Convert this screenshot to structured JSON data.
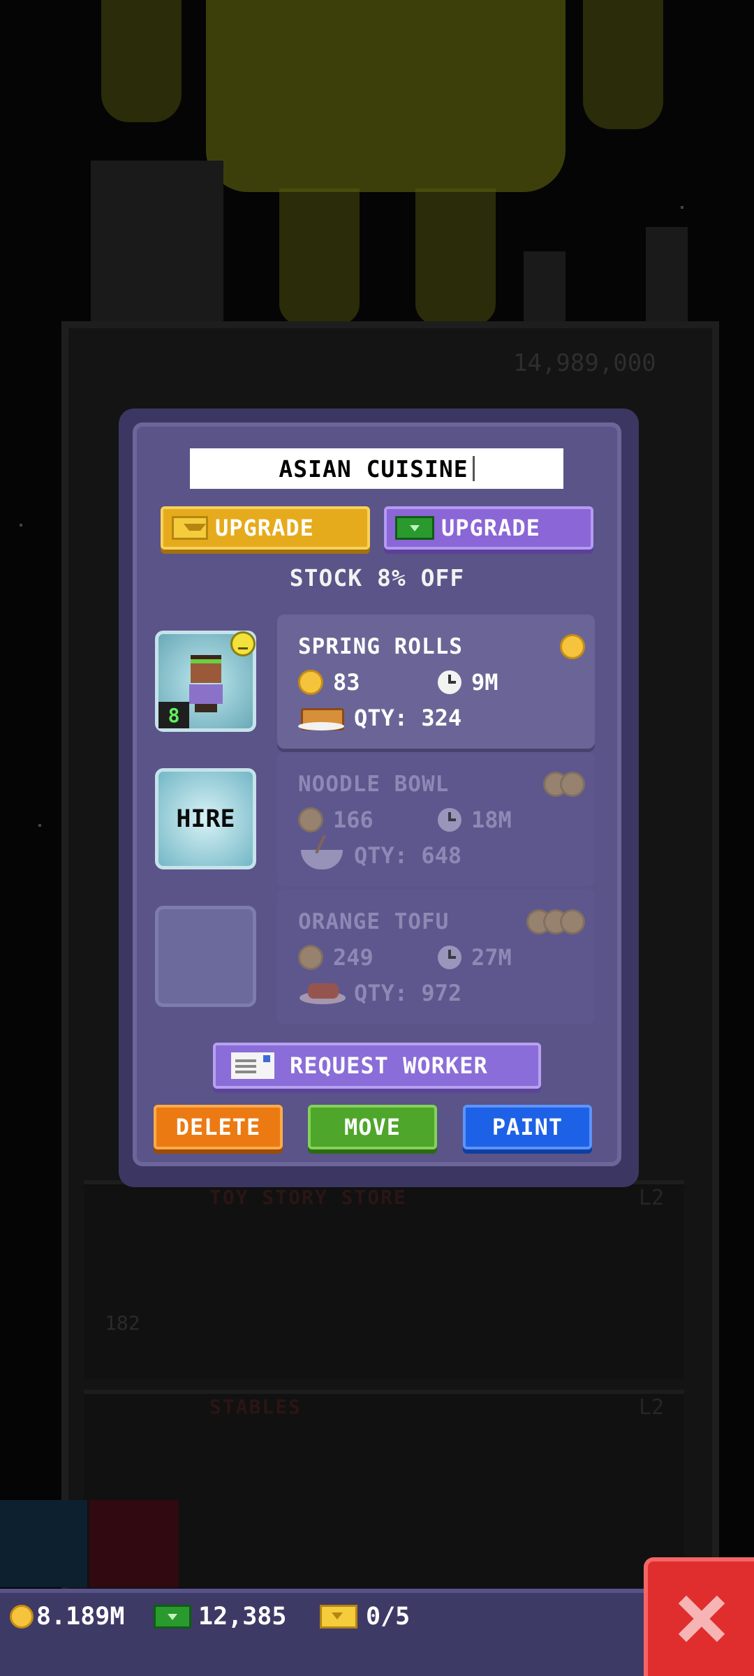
{
  "background": {
    "tower_price": "14,989,000",
    "floor_a": {
      "name": "TOY STORY STORE",
      "level": "L2"
    },
    "floor_b": {
      "name": "STABLES",
      "level": "L2"
    },
    "floor_number": "182"
  },
  "modal": {
    "floor_name": "ASIAN CUISINE",
    "upgrade_coins_label": "UPGRADE",
    "upgrade_bux_label": "UPGRADE",
    "stock_discount": "STOCK 8% OFF",
    "workers": [
      {
        "state": "hired",
        "level": "8"
      },
      {
        "state": "hire",
        "label": "HIRE"
      },
      {
        "state": "locked"
      }
    ],
    "stocks": [
      {
        "name": "SPRING ROLLS",
        "price": "83",
        "time": "9M",
        "qty": "QTY: 324",
        "coin_tier": 1,
        "active": true
      },
      {
        "name": "NOODLE BOWL",
        "price": "166",
        "time": "18M",
        "qty": "QTY: 648",
        "coin_tier": 2,
        "active": false
      },
      {
        "name": "ORANGE TOFU",
        "price": "249",
        "time": "27M",
        "qty": "QTY: 972",
        "coin_tier": 3,
        "active": false
      }
    ],
    "request_worker_label": "REQUEST WORKER",
    "actions": {
      "delete": "DELETE",
      "move": "MOVE",
      "paint": "PAINT"
    }
  },
  "bottom_bar": {
    "coins": "8.189M",
    "bux": "12,385",
    "tickets": "0/5"
  },
  "colors": {
    "modal_bg": "#5a5488",
    "gold": "#e6ab1c",
    "purple": "#8a66d6",
    "delete": "#ec7a12",
    "move": "#4ea62a",
    "paint": "#1d62e6",
    "close": "#e02e2e"
  },
  "icons": [
    "ticket-icon",
    "bux-icon",
    "coin-icon",
    "clock-icon",
    "envelope-icon",
    "close-icon",
    "mood-icon"
  ]
}
